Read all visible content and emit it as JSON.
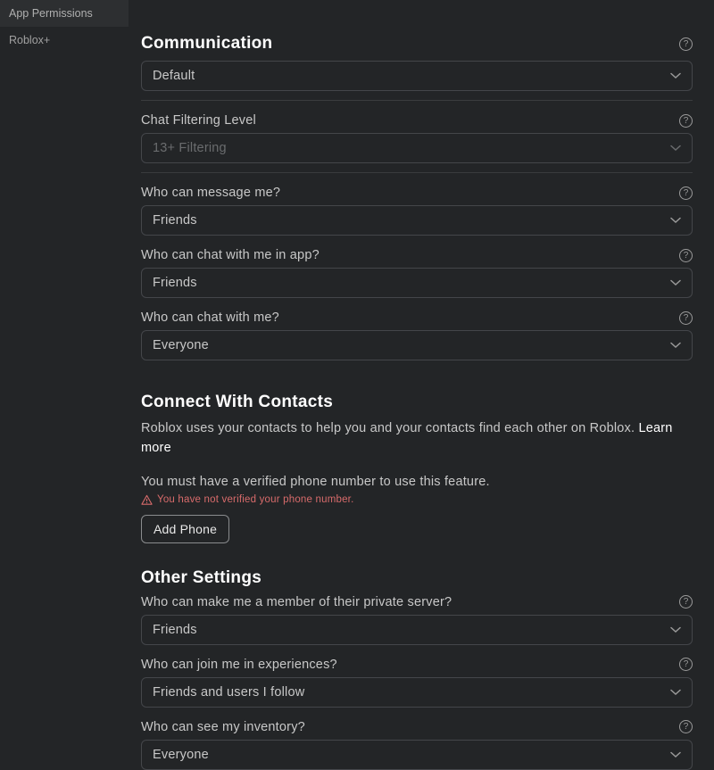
{
  "sidebar": {
    "tabs": [
      {
        "label": "App Permissions"
      },
      {
        "label": "Roblox+"
      }
    ]
  },
  "communication": {
    "title": "Communication",
    "default_select": "Default",
    "chat_filtering": {
      "label": "Chat Filtering Level",
      "value": "13+ Filtering"
    },
    "who_message": {
      "label": "Who can message me?",
      "value": "Friends"
    },
    "who_chat_app": {
      "label": "Who can chat with me in app?",
      "value": "Friends"
    },
    "who_chat": {
      "label": "Who can chat with me?",
      "value": "Everyone"
    }
  },
  "contacts": {
    "title": "Connect With Contacts",
    "desc": "Roblox uses your contacts to help you and your contacts find each other on Roblox. ",
    "learn_more": "Learn more",
    "must_verify": "You must have a verified phone number to use this feature.",
    "warning": "You have not verified your phone number.",
    "add_phone": "Add Phone"
  },
  "other": {
    "title": "Other Settings",
    "private_server": {
      "label": "Who can make me a member of their private server?",
      "value": "Friends"
    },
    "join_experiences": {
      "label": "Who can join me in experiences?",
      "value": "Friends and users I follow"
    },
    "see_inventory": {
      "label": "Who can see my inventory?",
      "value": "Everyone"
    }
  }
}
